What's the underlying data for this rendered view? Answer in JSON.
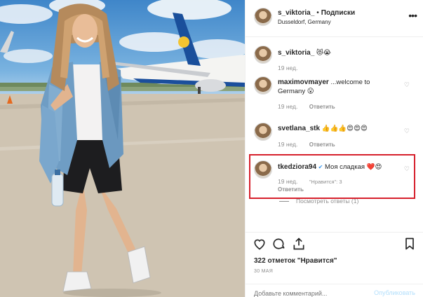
{
  "header": {
    "username": "s_viktoria_",
    "separator": "•",
    "follow_label": "Подписки",
    "location": "Dusseldorf, Germany",
    "more_icon": "more-horizontal-icon"
  },
  "comments": [
    {
      "username": "s_viktoria_",
      "text": "😻😭",
      "age": "19 нед.",
      "likes": "",
      "reply_label": ""
    },
    {
      "username": "maximovmayer",
      "text": "...welcome to Germany 😮",
      "age": "19 нед.",
      "likes": "",
      "reply_label": "Ответить"
    },
    {
      "username": "svetlana_stk",
      "text": "👍👍👍😍😍😍",
      "age": "19 нед.",
      "likes": "",
      "reply_label": "Ответить"
    },
    {
      "username": "tkedziora94",
      "verified": "✔",
      "text": "Моя сладкая ❤️😍",
      "age": "19 нед.",
      "likes": "\"Нравится\": 3",
      "reply_label": "Ответить"
    }
  ],
  "view_replies": "Посмотреть ответы (1)",
  "actions": {
    "like_icon": "heart-icon",
    "comment_icon": "comment-icon",
    "share_icon": "share-icon",
    "save_icon": "bookmark-icon"
  },
  "likes_text": "322 отметок \"Нравится\"",
  "date": "30 МАЯ",
  "add_comment": {
    "placeholder": "Добавьте комментарий...",
    "publish_label": "Опубликовать"
  },
  "colors": {
    "highlight": "#d6202c",
    "verified": "#3897f0",
    "muted": "#8e8e8e"
  }
}
